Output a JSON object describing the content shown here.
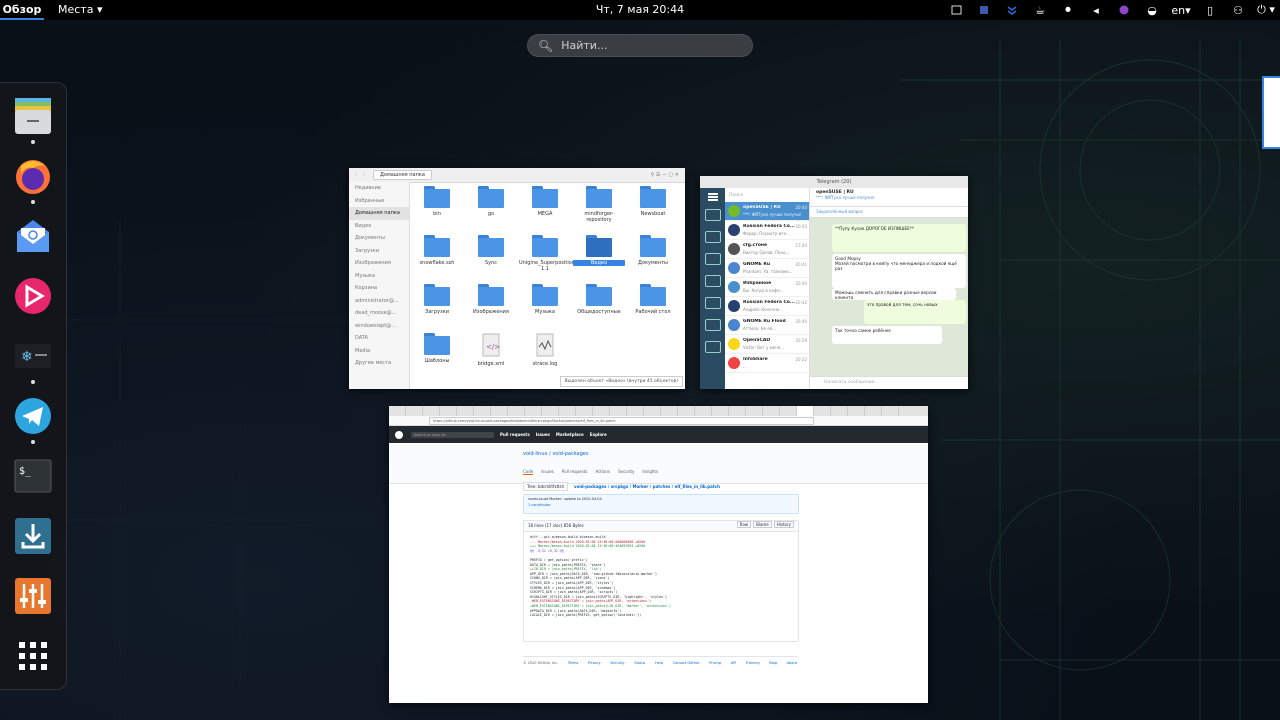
{
  "topbar": {
    "activities": "Обзор",
    "places": "Места",
    "clock": "Чт, 7 мая  20:44",
    "lang": "en"
  },
  "search": {
    "placeholder": "Найти..."
  },
  "dock": {
    "items": [
      "files-app",
      "firefox",
      "mail",
      "music",
      "snowflake",
      "telegram",
      "terminal",
      "downloader",
      "mixer",
      "app-grid"
    ]
  },
  "files_window": {
    "sidebar": [
      "Недавние",
      "Избранные",
      "Домашняя папка",
      "Видео",
      "Документы",
      "Загрузки",
      "Изображения",
      "Музыка",
      "Корзина",
      "administrator@...",
      "dead_moose@...",
      "windowslapt@...",
      "DATA",
      "Media",
      "Другие места"
    ],
    "path": "Домашняя папка",
    "items": [
      "bin",
      "go",
      "MEGA",
      "mindforger-repository",
      "Newsboat",
      "snowflake.ssh",
      "Sync",
      "Unigine_Superposition-1.1",
      "Видео",
      "Документы",
      "Загрузки",
      "Изображения",
      "Музыка",
      "Общедоступные",
      "Рабочий стол",
      "Шаблоны",
      "bridge.xml",
      "strace.log"
    ],
    "status": "Выделен объект «Видео» (внутри 45 объектов)"
  },
  "telegram_window": {
    "title": "Telegram (20)",
    "search": "Поиск",
    "chats": [
      {
        "name": "openSUSE | RU",
        "time": "20:44",
        "preview": "***: ФЙТуна лучше получил"
      },
      {
        "name": "Russian Fedora Co...",
        "time": "20:43",
        "preview": "Федор: Посмотр-ите..."
      },
      {
        "name": "cfg.стоне",
        "time": "17:44",
        "preview": "Виктор Орлов: Пено..."
      },
      {
        "name": "GNOME Ru",
        "time": "20:41",
        "preview": "Phantom: Уа, толкамо..."
      },
      {
        "name": "Избранное",
        "time": "20:40",
        "preview": "Вы: Когда в кафе..."
      },
      {
        "name": "Russian Fedora Co...",
        "time": "20:42",
        "preview": "Андрей: Конечно..."
      },
      {
        "name": "GNOME Ru Flood",
        "time": "20:40",
        "preview": "Аттила: Не её..."
      },
      {
        "name": "OpenSCAD",
        "time": "20:29",
        "preview": "Victor: Вот у меня..."
      },
      {
        "name": "InfoShare",
        "time": "20:22",
        "preview": "..."
      }
    ],
    "conv_title": "openSUSE | RU",
    "conv_sub": "***: ФЙТуна лучше получил",
    "pinned": "Закреплённый вопрос",
    "messages": [
      "**Пупу Кусик ДОРОГОЕ ИЗЛИШЕЕ**",
      "Good Mopsy",
      "Мозей посмотри в кейпу что менеджера и подкой ещё раз",
      "Можешь сменить для справки разные версии клиента",
      "это правой для тем, сочь новых",
      "Так точно самое ребёнке"
    ],
    "input": "Написать сообщение..."
  },
  "browser_window": {
    "url": "https://github.com/void-linux/void-packages/blob/bdcmlitfx/srcpkgs/Marker/patches/elf_files_in_lib.patch",
    "gh_search": "Search or jump to...",
    "gh_nav": [
      "Pull requests",
      "Issues",
      "Marketplace",
      "Explore"
    ],
    "repo": "void-linux / void-packages",
    "repo_tabs": [
      "Code",
      "Issues",
      "Pull requests",
      "Actions",
      "Security",
      "Insights"
    ],
    "branch": "Tree: bdcmlitfxtlsh",
    "breadcrumb": "void-packages / srcpkgs / Marker / patches / elf_files_in_lib.patch",
    "commit": "nodal.ssuat Marker: update to 2020.04.04",
    "contributor": "1 contributor",
    "file_info": "18 lines (17 sloc)   856 Bytes",
    "file_buttons": [
      "Raw",
      "Blame",
      "History"
    ],
    "lines": [
      {
        "k": "",
        "t": "diff --git a/meson.build b/meson.build"
      },
      {
        "k": "del",
        "t": "--- Marker/meson.build  2020-03-08 14:09:00.000000000 +0200"
      },
      {
        "k": "add",
        "t": "+++ Marker/meson.build  2020-03-08 15:36:00.404897893 +0200"
      },
      {
        "k": "hunk",
        "t": "@@ -9,32 +9,32 @@"
      },
      {
        "k": "",
        "t": ""
      },
      {
        "k": "",
        "t": " PREFIX = get_option('prefix')"
      },
      {
        "k": "",
        "t": " DATA_DIR = join_paths(PREFIX, 'share')"
      },
      {
        "k": "add",
        "t": "+LIB_DIR = join_paths(PREFIX, 'lib')"
      },
      {
        "k": "",
        "t": " APP_DIR = join_paths(DATA_DIR, 'com.github.fabiocolacio.marker')"
      },
      {
        "k": "",
        "t": " ICONS_DIR = join_paths(APP_DIR, 'icons')"
      },
      {
        "k": "",
        "t": " STYLES_DIR = join_paths(APP_DIR, 'styles')"
      },
      {
        "k": "",
        "t": " SCHEMA_DIR = join_paths(APP_DIR, 'schemas')"
      },
      {
        "k": "",
        "t": " SCRIPTS_DIR = join_paths(APP_DIR, 'scripts')"
      },
      {
        "k": "",
        "t": " HIGHLIGHT_STYLES_DIR = join_paths(SCRIPTS_DIR, 'highlight', 'styles')"
      },
      {
        "k": "del",
        "t": "-WEB_EXTENSIONS_DIRECTORY = join_paths(APP_DIR, 'extensions')"
      },
      {
        "k": "add",
        "t": "+WEB_EXTENSIONS_DIRECTORY = join_paths(LIB_DIR, 'marker', 'extensions')"
      },
      {
        "k": "",
        "t": " APPDATA_DIR = join_paths(DATA_DIR, 'metainfo')"
      },
      {
        "k": "",
        "t": " LOCALE_DIR = join_paths(PREFIX, get_option('localedir'))"
      }
    ],
    "footer_left": "© 2020 GitHub, Inc.",
    "footer_links": [
      "Terms",
      "Privacy",
      "Security",
      "Status",
      "Help",
      "Contact GitHub",
      "Pricing",
      "API",
      "Training",
      "Blog",
      "About"
    ]
  },
  "colors": {
    "accent": "#3584e4",
    "folder": "#4a95e6",
    "telegram_sidebar": "#2b4b63",
    "github_header": "#24292e"
  }
}
